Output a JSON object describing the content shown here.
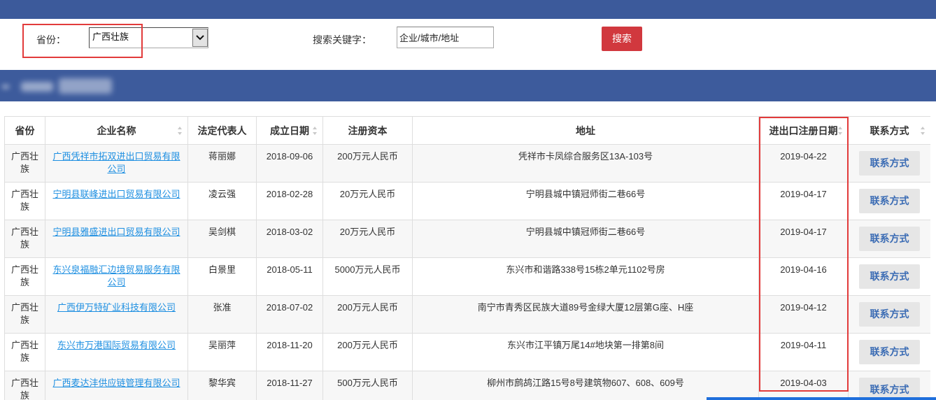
{
  "colors": {
    "header_bar": "#3c5a9b",
    "band": "#3d5b9c",
    "search_button": "#d1383e",
    "highlight": "#e23b3b",
    "link": "#1e8fe1",
    "contact_text": "#3b6cb4",
    "contact_bg": "#e6e6e6",
    "bottom_line": "#1f6fdc"
  },
  "search": {
    "province_label": "省份：",
    "province_selected": "广西壮族",
    "keyword_label": "搜索关键字：",
    "keyword_value": "企业/城市/地址",
    "search_button": "搜索"
  },
  "table": {
    "headers": [
      {
        "label": "省份",
        "sortable": false
      },
      {
        "label": "企业名称",
        "sortable": true
      },
      {
        "label": "法定代表人",
        "sortable": false
      },
      {
        "label": "成立日期",
        "sortable": true
      },
      {
        "label": "注册资本",
        "sortable": false
      },
      {
        "label": "地址",
        "sortable": false
      },
      {
        "label": "进出口注册日期",
        "sortable": true
      },
      {
        "label": "联系方式",
        "sortable": true
      }
    ],
    "rows": [
      {
        "province": "广西壮族",
        "company": "广西凭祥市拓双进出口贸易有限公司",
        "legal_rep": "蒋丽娜",
        "founded": "2018-09-06",
        "capital": "200万元人民币",
        "address": "凭祥市卡凤综合服务区13A-103号",
        "ie_registration_date": "2019-04-22",
        "contact": "联系方式"
      },
      {
        "province": "广西壮族",
        "company": "宁明县联峰进出口贸易有限公司",
        "legal_rep": "凌云强",
        "founded": "2018-02-28",
        "capital": "20万元人民币",
        "address": "宁明县城中镇冠师街二巷66号",
        "ie_registration_date": "2019-04-17",
        "contact": "联系方式"
      },
      {
        "province": "广西壮族",
        "company": "宁明县雅盛进出口贸易有限公司",
        "legal_rep": "吴剑棋",
        "founded": "2018-03-02",
        "capital": "20万元人民币",
        "address": "宁明县城中镇冠师街二巷66号",
        "ie_registration_date": "2019-04-17",
        "contact": "联系方式"
      },
      {
        "province": "广西壮族",
        "company": "东兴泉福融汇边境贸易服务有限公司",
        "legal_rep": "白景里",
        "founded": "2018-05-11",
        "capital": "5000万元人民币",
        "address": "东兴市和谐路338号15栋2单元1102号房",
        "ie_registration_date": "2019-04-16",
        "contact": "联系方式"
      },
      {
        "province": "广西壮族",
        "company": "广西伊万特矿业科技有限公司",
        "legal_rep": "张准",
        "founded": "2018-07-02",
        "capital": "200万元人民币",
        "address": "南宁市青秀区民族大道89号金绿大厦12层第G座、H座",
        "ie_registration_date": "2019-04-12",
        "contact": "联系方式"
      },
      {
        "province": "广西壮族",
        "company": "东兴市万港国际贸易有限公司",
        "legal_rep": "吴丽萍",
        "founded": "2018-11-20",
        "capital": "200万元人民币",
        "address": "东兴市江平镇万尾14#地块第一排第8间",
        "ie_registration_date": "2019-04-11",
        "contact": "联系方式"
      },
      {
        "province": "广西壮族",
        "company": "广西麦达沣供应链管理有限公司",
        "legal_rep": "黎华宾",
        "founded": "2018-11-27",
        "capital": "500万元人民币",
        "address": "柳州市鹧鸪江路15号8号建筑物607、608、609号",
        "ie_registration_date": "2019-04-03",
        "contact": "联系方式"
      }
    ]
  }
}
